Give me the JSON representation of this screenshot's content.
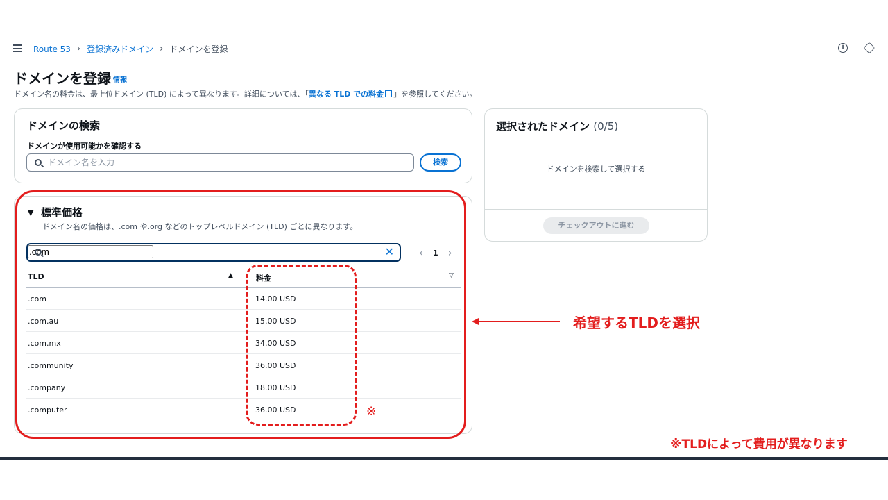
{
  "breadcrumb": {
    "items": [
      "Route 53",
      "登録済みドメイン"
    ],
    "current": "ドメインを登録"
  },
  "header": {
    "title": "ドメインを登録",
    "info_link": "情報",
    "description_before": "ドメイン名の料金は、最上位ドメイン (TLD) によって異なります。詳細については、「",
    "description_link": "異なる TLD での料金",
    "description_after": "」を参照してください。"
  },
  "search_card": {
    "title": "ドメインの検索",
    "field_label": "ドメインが使用可能かを確認する",
    "placeholder": "ドメイン名を入力",
    "button_label": "検索"
  },
  "pricing": {
    "title": "標準価格",
    "description": "ドメイン名の価格は、.com や.org などのトップレベルドメイン (TLD) ごとに異なります。",
    "filter_value": ".com",
    "page_number": "1",
    "columns": {
      "tld": "TLD",
      "price": "料金"
    },
    "rows": [
      {
        "tld": ".com",
        "price": "14.00 USD"
      },
      {
        "tld": ".com.au",
        "price": "15.00 USD"
      },
      {
        "tld": ".com.mx",
        "price": "34.00 USD"
      },
      {
        "tld": ".community",
        "price": "36.00 USD"
      },
      {
        "tld": ".company",
        "price": "18.00 USD"
      },
      {
        "tld": ".computer",
        "price": "36.00 USD"
      }
    ]
  },
  "selected_domains": {
    "title": "選択されたドメイン",
    "count": "(0/5)",
    "empty_text": "ドメインを検索して選択する",
    "checkout_label": "チェックアウトに進む"
  },
  "annotations": {
    "select_tld": "希望するTLDを選択",
    "mark": "※",
    "note": "※TLDによって費用が異なります",
    "color": "#e31d1d"
  },
  "icons": {
    "menu": "hamburger-icon",
    "info": "info-icon",
    "settings": "hexagon-icon",
    "search": "search-icon",
    "clear": "close-icon",
    "external": "external-link-icon"
  },
  "colors": {
    "link": "#0972d3",
    "text": "#0f141a",
    "secondary_text": "#414d5c"
  }
}
